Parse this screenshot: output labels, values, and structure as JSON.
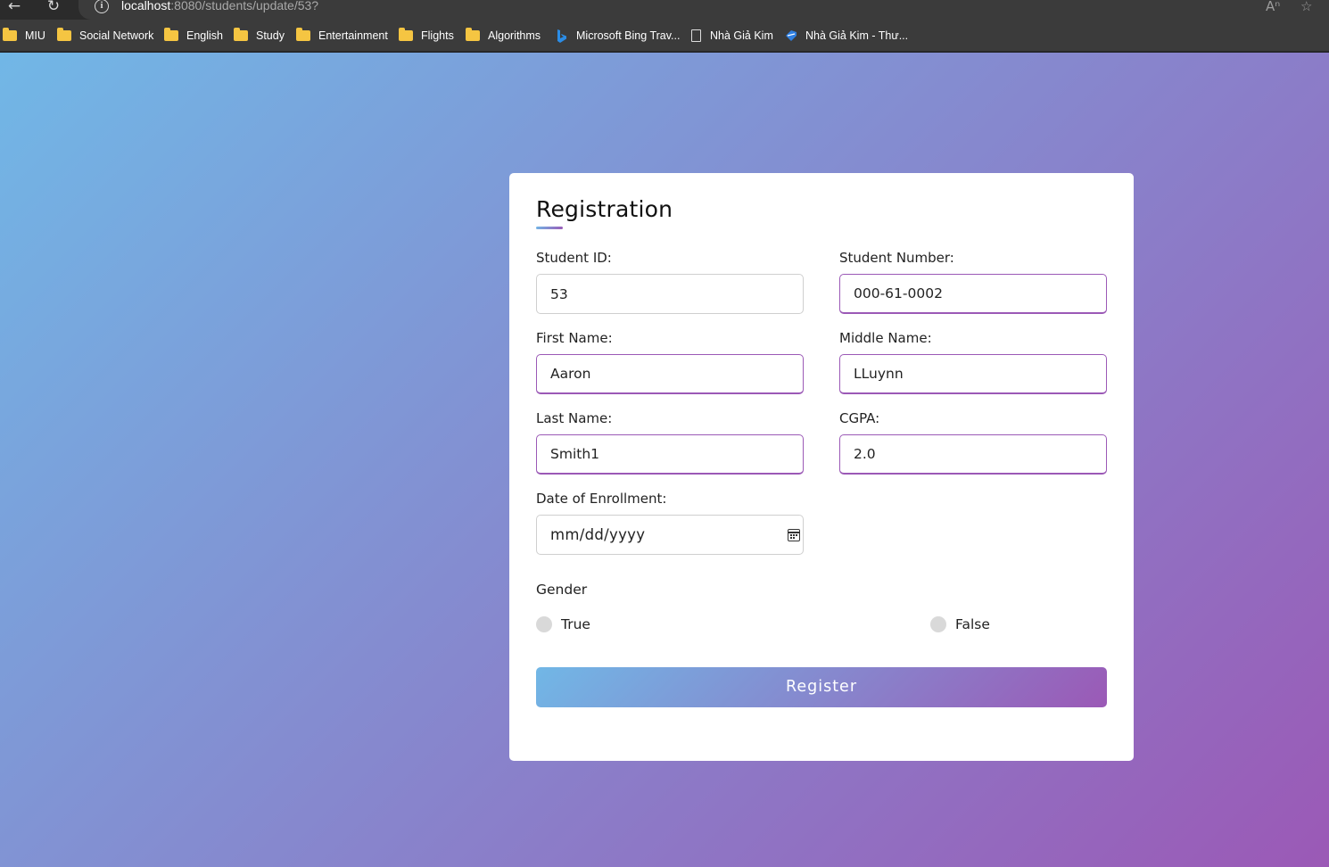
{
  "browser": {
    "url_host": "localhost",
    "url_rest": ":8080/students/update/53?",
    "bookmarks": [
      {
        "label": "MIU",
        "icon": "folder-icon"
      },
      {
        "label": "Social Network",
        "icon": "folder-icon"
      },
      {
        "label": "English",
        "icon": "folder-icon"
      },
      {
        "label": "Study",
        "icon": "folder-icon"
      },
      {
        "label": "Entertainment",
        "icon": "folder-icon"
      },
      {
        "label": "Flights",
        "icon": "folder-icon"
      },
      {
        "label": "Algorithms",
        "icon": "folder-icon"
      },
      {
        "label": "Microsoft Bing Trav...",
        "icon": "bing-icon"
      },
      {
        "label": "Nhà Giả Kim",
        "icon": "document-icon"
      },
      {
        "label": "Nhà Giả Kim - Thư...",
        "icon": "tag-icon"
      }
    ]
  },
  "form": {
    "title": "Registration",
    "student_id": {
      "label": "Student ID:",
      "value": "53"
    },
    "student_number": {
      "label": "Student Number:",
      "value": "000-61-0002"
    },
    "first_name": {
      "label": "First Name:",
      "value": "Aaron"
    },
    "middle_name": {
      "label": "Middle Name:",
      "value": "LLuynn"
    },
    "last_name": {
      "label": "Last Name:",
      "value": "Smith1"
    },
    "cgpa": {
      "label": "CGPA:",
      "value": "2.0"
    },
    "enrollment_date": {
      "label": "Date of Enrollment:",
      "placeholder": "mm/dd/yyyy"
    },
    "gender": {
      "label": "Gender",
      "options": [
        "True",
        "False"
      ]
    },
    "submit_label": "Register"
  },
  "colors": {
    "gradient_start": "#71b7e6",
    "gradient_end": "#9b59b6",
    "focus_border": "#9b59b6"
  }
}
